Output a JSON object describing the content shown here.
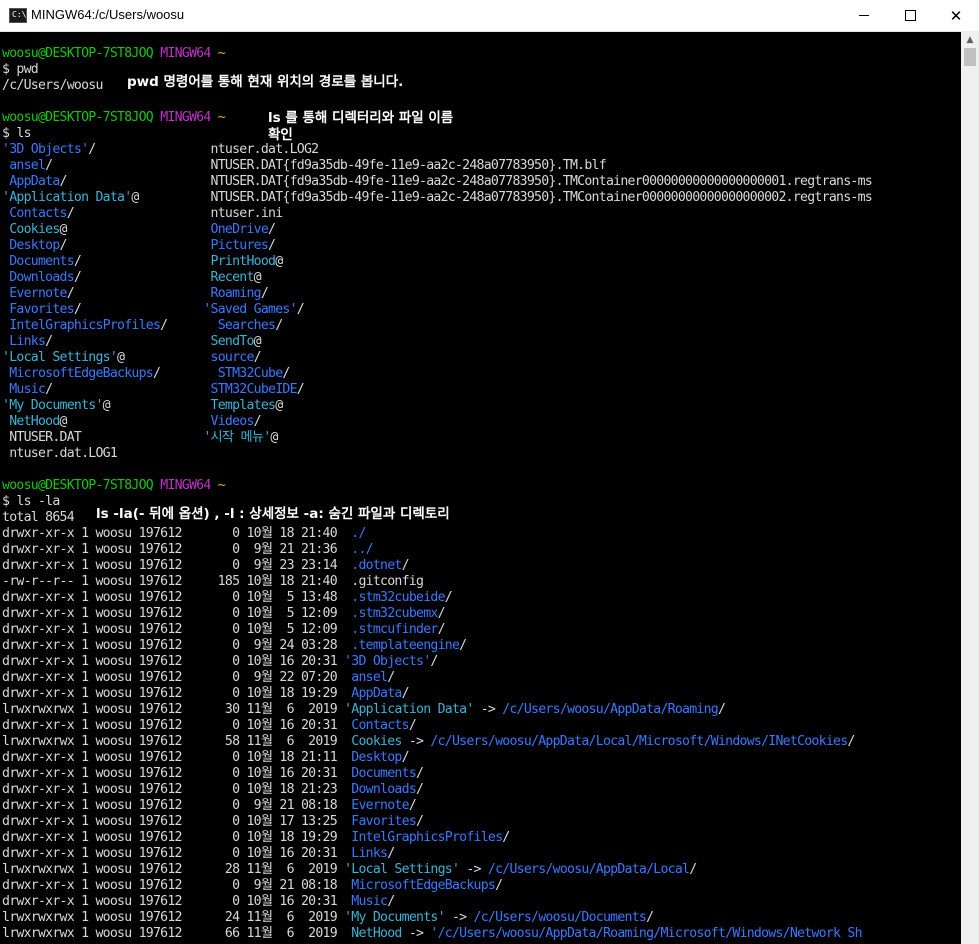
{
  "window": {
    "title": "MINGW64:/c/Users/woosu",
    "icon_text": "C:\\",
    "minimize_glyph": "minimize-icon",
    "maximize_glyph": "maximize-icon",
    "close_glyph": "✕"
  },
  "annotations": {
    "pwd": "pwd 명령어를 통해 현재 위치의 경로를 봅니다.",
    "ls_line1": "ls 를 통해 디렉터리와 파일 이름",
    "ls_line2": "확인",
    "la": "ls -la(- 뒤에 옵션) , -l : 상세정보  -a:  숨긴 파일과 디렉토리"
  },
  "terminal_lines": [
    [
      [
        "woosu@DESKTOP-7ST8JOQ",
        "green"
      ],
      [
        " ",
        ""
      ],
      [
        "MINGW64",
        "magenta"
      ],
      [
        " ~",
        "yellow"
      ]
    ],
    [
      [
        "$ pwd",
        "white"
      ]
    ],
    [
      [
        "/c/Users/woosu",
        "white"
      ]
    ],
    [
      [
        "",
        ""
      ]
    ],
    [
      [
        "woosu@DESKTOP-7ST8JOQ",
        "green"
      ],
      [
        " ",
        ""
      ],
      [
        "MINGW64",
        "magenta"
      ],
      [
        " ~",
        "yellow"
      ]
    ],
    [
      [
        "$ ls",
        "white"
      ]
    ],
    [
      [
        "'3D Objects'",
        "blue"
      ],
      [
        "/                ",
        "white"
      ],
      [
        "ntuser.dat.LOG2",
        "white"
      ]
    ],
    [
      [
        " ansel",
        "blue"
      ],
      [
        "/                      ",
        "white"
      ],
      [
        "NTUSER.DAT{fd9a35db-49fe-11e9-aa2c-248a07783950}.TM.blf",
        "white"
      ]
    ],
    [
      [
        " AppData",
        "blue"
      ],
      [
        "/                    ",
        "white"
      ],
      [
        "NTUSER.DAT{fd9a35db-49fe-11e9-aa2c-248a07783950}.TMContainer00000000000000000001.regtrans-ms",
        "white"
      ]
    ],
    [
      [
        "'Application Data'",
        "cyan"
      ],
      [
        "@          ",
        "white"
      ],
      [
        "NTUSER.DAT{fd9a35db-49fe-11e9-aa2c-248a07783950}.TMContainer00000000000000000002.regtrans-ms",
        "white"
      ]
    ],
    [
      [
        " Contacts",
        "blue"
      ],
      [
        "/                   ",
        "white"
      ],
      [
        "ntuser.ini",
        "white"
      ]
    ],
    [
      [
        " Cookies",
        "cyan"
      ],
      [
        "@                    ",
        "white"
      ],
      [
        "OneDrive",
        "blue"
      ],
      [
        "/",
        "white"
      ]
    ],
    [
      [
        " Desktop",
        "blue"
      ],
      [
        "/                    ",
        "white"
      ],
      [
        "Pictures",
        "blue"
      ],
      [
        "/",
        "white"
      ]
    ],
    [
      [
        " Documents",
        "blue"
      ],
      [
        "/                  ",
        "white"
      ],
      [
        "PrintHood",
        "cyan"
      ],
      [
        "@",
        "white"
      ]
    ],
    [
      [
        " Downloads",
        "blue"
      ],
      [
        "/                  ",
        "white"
      ],
      [
        "Recent",
        "cyan"
      ],
      [
        "@",
        "white"
      ]
    ],
    [
      [
        " Evernote",
        "blue"
      ],
      [
        "/                   ",
        "white"
      ],
      [
        "Roaming",
        "blue"
      ],
      [
        "/",
        "white"
      ]
    ],
    [
      [
        " Favorites",
        "blue"
      ],
      [
        "/                 ",
        "white"
      ],
      [
        "'Saved Games'",
        "blue"
      ],
      [
        "/",
        "white"
      ]
    ],
    [
      [
        " IntelGraphicsProfiles",
        "blue"
      ],
      [
        "/       ",
        "white"
      ],
      [
        "Searches",
        "blue"
      ],
      [
        "/",
        "white"
      ]
    ],
    [
      [
        " Links",
        "blue"
      ],
      [
        "/                      ",
        "white"
      ],
      [
        "SendTo",
        "cyan"
      ],
      [
        "@",
        "white"
      ]
    ],
    [
      [
        "'Local Settings'",
        "cyan"
      ],
      [
        "@            ",
        "white"
      ],
      [
        "source",
        "blue"
      ],
      [
        "/",
        "white"
      ]
    ],
    [
      [
        " MicrosoftEdgeBackups",
        "blue"
      ],
      [
        "/        ",
        "white"
      ],
      [
        "STM32Cube",
        "blue"
      ],
      [
        "/",
        "white"
      ]
    ],
    [
      [
        " Music",
        "blue"
      ],
      [
        "/                      ",
        "white"
      ],
      [
        "STM32CubeIDE",
        "blue"
      ],
      [
        "/",
        "white"
      ]
    ],
    [
      [
        "'My Documents'",
        "cyan"
      ],
      [
        "@              ",
        "white"
      ],
      [
        "Templates",
        "cyan"
      ],
      [
        "@",
        "white"
      ]
    ],
    [
      [
        " NetHood",
        "cyan"
      ],
      [
        "@                    ",
        "white"
      ],
      [
        "Videos",
        "blue"
      ],
      [
        "/",
        "white"
      ]
    ],
    [
      [
        " NTUSER.DAT                 ",
        "white"
      ],
      [
        "'시작 메뉴'",
        "cyan"
      ],
      [
        "@",
        "white"
      ]
    ],
    [
      [
        " ntuser.dat.LOG1",
        "white"
      ]
    ],
    [
      [
        "",
        ""
      ]
    ],
    [
      [
        "woosu@DESKTOP-7ST8JOQ",
        "green"
      ],
      [
        " ",
        ""
      ],
      [
        "MINGW64",
        "magenta"
      ],
      [
        " ~",
        "yellow"
      ]
    ],
    [
      [
        "$ ls -la",
        "white"
      ]
    ],
    [
      [
        "total 8654",
        "white"
      ]
    ],
    [
      [
        "drwxr-xr-x 1 woosu 197612       0 10월 18 21:40  ",
        "white"
      ],
      [
        "./",
        "blue"
      ]
    ],
    [
      [
        "drwxr-xr-x 1 woosu 197612       0  9월 21 21:36  ",
        "white"
      ],
      [
        "../",
        "blue"
      ]
    ],
    [
      [
        "drwxr-xr-x 1 woosu 197612       0  9월 23 23:14  ",
        "white"
      ],
      [
        ".dotnet",
        "blue"
      ],
      [
        "/",
        "white"
      ]
    ],
    [
      [
        "-rw-r--r-- 1 woosu 197612     185 10월 18 21:40  .gitconfig",
        "white"
      ]
    ],
    [
      [
        "drwxr-xr-x 1 woosu 197612       0 10월  5 13:48  ",
        "white"
      ],
      [
        ".stm32cubeide",
        "blue"
      ],
      [
        "/",
        "white"
      ]
    ],
    [
      [
        "drwxr-xr-x 1 woosu 197612       0 10월  5 12:09  ",
        "white"
      ],
      [
        ".stm32cubemx",
        "blue"
      ],
      [
        "/",
        "white"
      ]
    ],
    [
      [
        "drwxr-xr-x 1 woosu 197612       0 10월  5 12:09  ",
        "white"
      ],
      [
        ".stmcufinder",
        "blue"
      ],
      [
        "/",
        "white"
      ]
    ],
    [
      [
        "drwxr-xr-x 1 woosu 197612       0  9월 24 03:28  ",
        "white"
      ],
      [
        ".templateengine",
        "blue"
      ],
      [
        "/",
        "white"
      ]
    ],
    [
      [
        "drwxr-xr-x 1 woosu 197612       0 10월 16 20:31 ",
        "white"
      ],
      [
        "'3D Objects'",
        "blue"
      ],
      [
        "/",
        "white"
      ]
    ],
    [
      [
        "drwxr-xr-x 1 woosu 197612       0  9월 22 07:20  ",
        "white"
      ],
      [
        "ansel",
        "blue"
      ],
      [
        "/",
        "white"
      ]
    ],
    [
      [
        "drwxr-xr-x 1 woosu 197612       0 10월 18 19:29  ",
        "white"
      ],
      [
        "AppData",
        "blue"
      ],
      [
        "/",
        "white"
      ]
    ],
    [
      [
        "lrwxrwxrwx 1 woosu 197612      30 11월  6  2019 ",
        "white"
      ],
      [
        "'Application Data'",
        "cyan"
      ],
      [
        " -> ",
        "white"
      ],
      [
        "/c/Users/woosu/AppData/Roaming",
        "blue"
      ],
      [
        "/",
        "white"
      ]
    ],
    [
      [
        "drwxr-xr-x 1 woosu 197612       0 10월 16 20:31  ",
        "white"
      ],
      [
        "Contacts",
        "blue"
      ],
      [
        "/",
        "white"
      ]
    ],
    [
      [
        "lrwxrwxrwx 1 woosu 197612      58 11월  6  2019  ",
        "white"
      ],
      [
        "Cookies",
        "cyan"
      ],
      [
        " -> ",
        "white"
      ],
      [
        "/c/Users/woosu/AppData/Local/Microsoft/Windows/INetCookies",
        "blue"
      ],
      [
        "/",
        "white"
      ]
    ],
    [
      [
        "drwxr-xr-x 1 woosu 197612       0 10월 18 21:11  ",
        "white"
      ],
      [
        "Desktop",
        "blue"
      ],
      [
        "/",
        "white"
      ]
    ],
    [
      [
        "drwxr-xr-x 1 woosu 197612       0 10월 16 20:31  ",
        "white"
      ],
      [
        "Documents",
        "blue"
      ],
      [
        "/",
        "white"
      ]
    ],
    [
      [
        "drwxr-xr-x 1 woosu 197612       0 10월 18 21:23  ",
        "white"
      ],
      [
        "Downloads",
        "blue"
      ],
      [
        "/",
        "white"
      ]
    ],
    [
      [
        "drwxr-xr-x 1 woosu 197612       0  9월 21 08:18  ",
        "white"
      ],
      [
        "Evernote",
        "blue"
      ],
      [
        "/",
        "white"
      ]
    ],
    [
      [
        "drwxr-xr-x 1 woosu 197612       0 10월 17 13:25  ",
        "white"
      ],
      [
        "Favorites",
        "blue"
      ],
      [
        "/",
        "white"
      ]
    ],
    [
      [
        "drwxr-xr-x 1 woosu 197612       0 10월 18 19:29  ",
        "white"
      ],
      [
        "IntelGraphicsProfiles",
        "blue"
      ],
      [
        "/",
        "white"
      ]
    ],
    [
      [
        "drwxr-xr-x 1 woosu 197612       0 10월 16 20:31  ",
        "white"
      ],
      [
        "Links",
        "blue"
      ],
      [
        "/",
        "white"
      ]
    ],
    [
      [
        "lrwxrwxrwx 1 woosu 197612      28 11월  6  2019 ",
        "white"
      ],
      [
        "'Local Settings'",
        "cyan"
      ],
      [
        " -> ",
        "white"
      ],
      [
        "/c/Users/woosu/AppData/Local",
        "blue"
      ],
      [
        "/",
        "white"
      ]
    ],
    [
      [
        "drwxr-xr-x 1 woosu 197612       0  9월 21 08:18  ",
        "white"
      ],
      [
        "MicrosoftEdgeBackups",
        "blue"
      ],
      [
        "/",
        "white"
      ]
    ],
    [
      [
        "drwxr-xr-x 1 woosu 197612       0 10월 16 20:31  ",
        "white"
      ],
      [
        "Music",
        "blue"
      ],
      [
        "/",
        "white"
      ]
    ],
    [
      [
        "lrwxrwxrwx 1 woosu 197612      24 11월  6  2019 ",
        "white"
      ],
      [
        "'My Documents'",
        "cyan"
      ],
      [
        " -> ",
        "white"
      ],
      [
        "/c/Users/woosu/Documents",
        "blue"
      ],
      [
        "/",
        "white"
      ]
    ],
    [
      [
        "lrwxrwxrwx 1 woosu 197612      66 11월  6  2019  ",
        "white"
      ],
      [
        "NetHood",
        "cyan"
      ],
      [
        " -> ",
        "white"
      ],
      [
        "'/c/Users/woosu/AppData/Roaming/Microsoft/Windows/Network Sh",
        "blue"
      ]
    ]
  ],
  "scrollbar": {
    "up_glyph": "▲"
  }
}
